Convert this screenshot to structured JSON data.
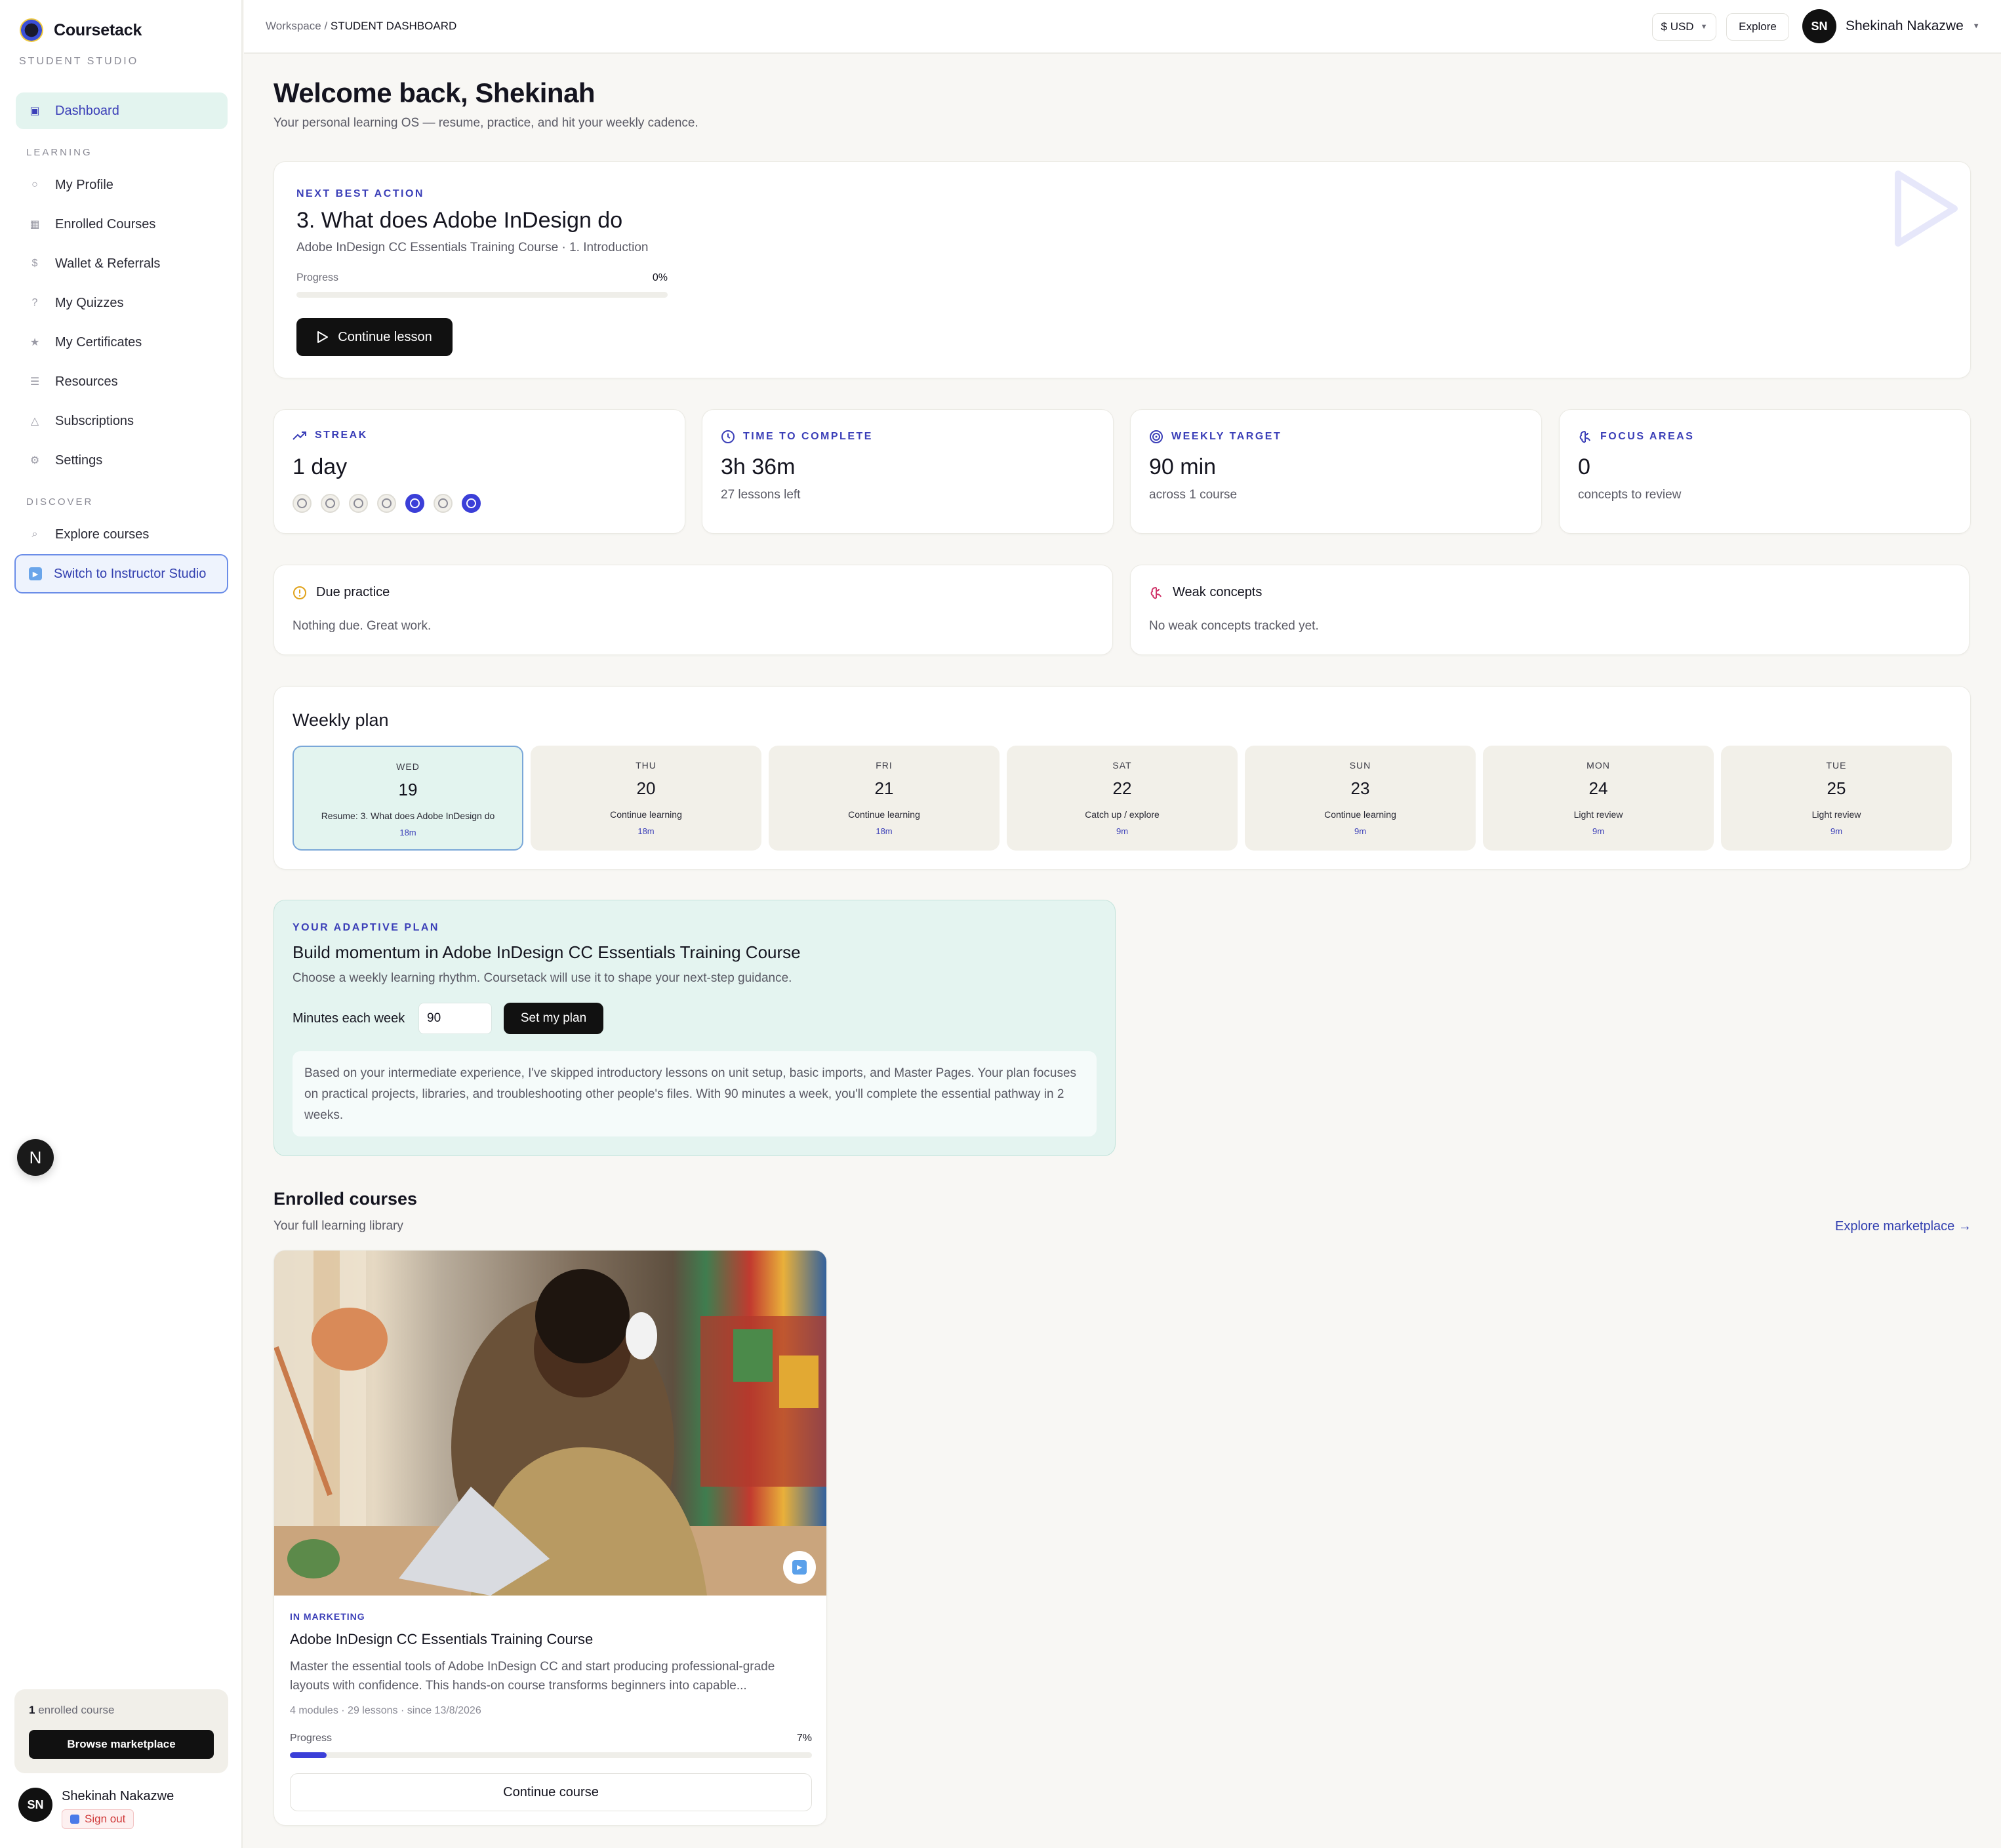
{
  "brand": {
    "name": "Coursetack",
    "subtitle": "STUDENT STUDIO"
  },
  "sidebar": {
    "dashboard": "Dashboard",
    "section_learning": "LEARNING",
    "learning_items": [
      {
        "label": "My Profile",
        "icon": "user-icon"
      },
      {
        "label": "Enrolled Courses",
        "icon": "book-icon"
      },
      {
        "label": "Wallet & Referrals",
        "icon": "dollar-icon"
      },
      {
        "label": "My Quizzes",
        "icon": "question-icon"
      },
      {
        "label": "My Certificates",
        "icon": "star-icon"
      },
      {
        "label": "Resources",
        "icon": "list-icon"
      },
      {
        "label": "Subscriptions",
        "icon": "bell-icon"
      },
      {
        "label": "Settings",
        "icon": "gear-icon"
      }
    ],
    "section_discover": "DISCOVER",
    "explore": "Explore courses",
    "switch": "Switch to Instructor Studio",
    "floating_badge": "N",
    "enrolled_count": "1",
    "enrolled_label": "enrolled course",
    "browse": "Browse marketplace",
    "user_initials": "SN",
    "user_name": "Shekinah Nakazwe",
    "sign_out": "Sign out"
  },
  "topbar": {
    "crumb_root": "Workspace /",
    "crumb_current": "STUDENT DASHBOARD",
    "currency": "$ USD",
    "explore": "Explore",
    "user_initials": "SN",
    "user_name": "Shekinah Nakazwe"
  },
  "welcome": {
    "title": "Welcome back, Shekinah",
    "subtitle": "Your personal learning OS — resume, practice, and hit your weekly cadence."
  },
  "next_action": {
    "eyebrow": "NEXT BEST ACTION",
    "title": "3. What does Adobe InDesign do",
    "subtitle": "Adobe InDesign CC Essentials Training Course · 1. Introduction",
    "progress_label": "Progress",
    "progress_text": "0%",
    "progress": 0,
    "button": "Continue lesson"
  },
  "stats": {
    "streak": {
      "label": "STREAK",
      "value": "1 day",
      "days": [
        false,
        false,
        false,
        false,
        true,
        false,
        true
      ]
    },
    "time": {
      "label": "TIME TO COMPLETE",
      "value": "3h 36m",
      "sub": "27 lessons left"
    },
    "target": {
      "label": "WEEKLY TARGET",
      "value": "90 min",
      "sub": "across 1 course"
    },
    "focus": {
      "label": "FOCUS AREAS",
      "value": "0",
      "sub": "concepts to review"
    }
  },
  "due_practice": {
    "title": "Due practice",
    "body": "Nothing due. Great work."
  },
  "weak_concepts": {
    "title": "Weak concepts",
    "body": "No weak concepts tracked yet."
  },
  "weekly_plan": {
    "title": "Weekly plan",
    "days": [
      {
        "name": "WED",
        "date": "19",
        "label": "Resume: 3. What does Adobe InDesign do",
        "minutes": "18m"
      },
      {
        "name": "THU",
        "date": "20",
        "label": "Continue learning",
        "minutes": "18m"
      },
      {
        "name": "FRI",
        "date": "21",
        "label": "Continue learning",
        "minutes": "18m"
      },
      {
        "name": "SAT",
        "date": "22",
        "label": "Catch up / explore",
        "minutes": "9m"
      },
      {
        "name": "SUN",
        "date": "23",
        "label": "Continue learning",
        "minutes": "9m"
      },
      {
        "name": "MON",
        "date": "24",
        "label": "Light review",
        "minutes": "9m"
      },
      {
        "name": "TUE",
        "date": "25",
        "label": "Light review",
        "minutes": "9m"
      }
    ]
  },
  "adaptive": {
    "eyebrow": "YOUR ADAPTIVE PLAN",
    "title": "Build momentum in Adobe InDesign CC Essentials Training Course",
    "subtitle": "Choose a weekly learning rhythm. Coursetack will use it to shape your next-step guidance.",
    "minutes_label": "Minutes each week",
    "minutes_value": "90",
    "button": "Set my plan",
    "note": "Based on your intermediate experience, I've skipped introductory lessons on unit setup, basic imports, and Master Pages. Your plan focuses on practical projects, libraries, and troubleshooting other people's files. With 90 minutes a week, you'll complete the essential pathway in 2 weeks."
  },
  "enrolled": {
    "title": "Enrolled courses",
    "subtitle": "Your full learning library",
    "link": "Explore marketplace →",
    "course": {
      "category": "IN MARKETING",
      "title": "Adobe InDesign CC Essentials Training Course",
      "description": "Master the essential tools of Adobe InDesign CC and start producing professional-grade layouts with confidence. This hands-on course transforms beginners into capable...",
      "meta": "4 modules · 29 lessons · since 13/8/2026",
      "progress_label": "Progress",
      "progress_text": "7%",
      "progress": 0.07,
      "button": "Continue course"
    }
  },
  "colors": {
    "accent": "#3b3fd8",
    "mint": "#e3f4ef",
    "dark": "#111111"
  }
}
